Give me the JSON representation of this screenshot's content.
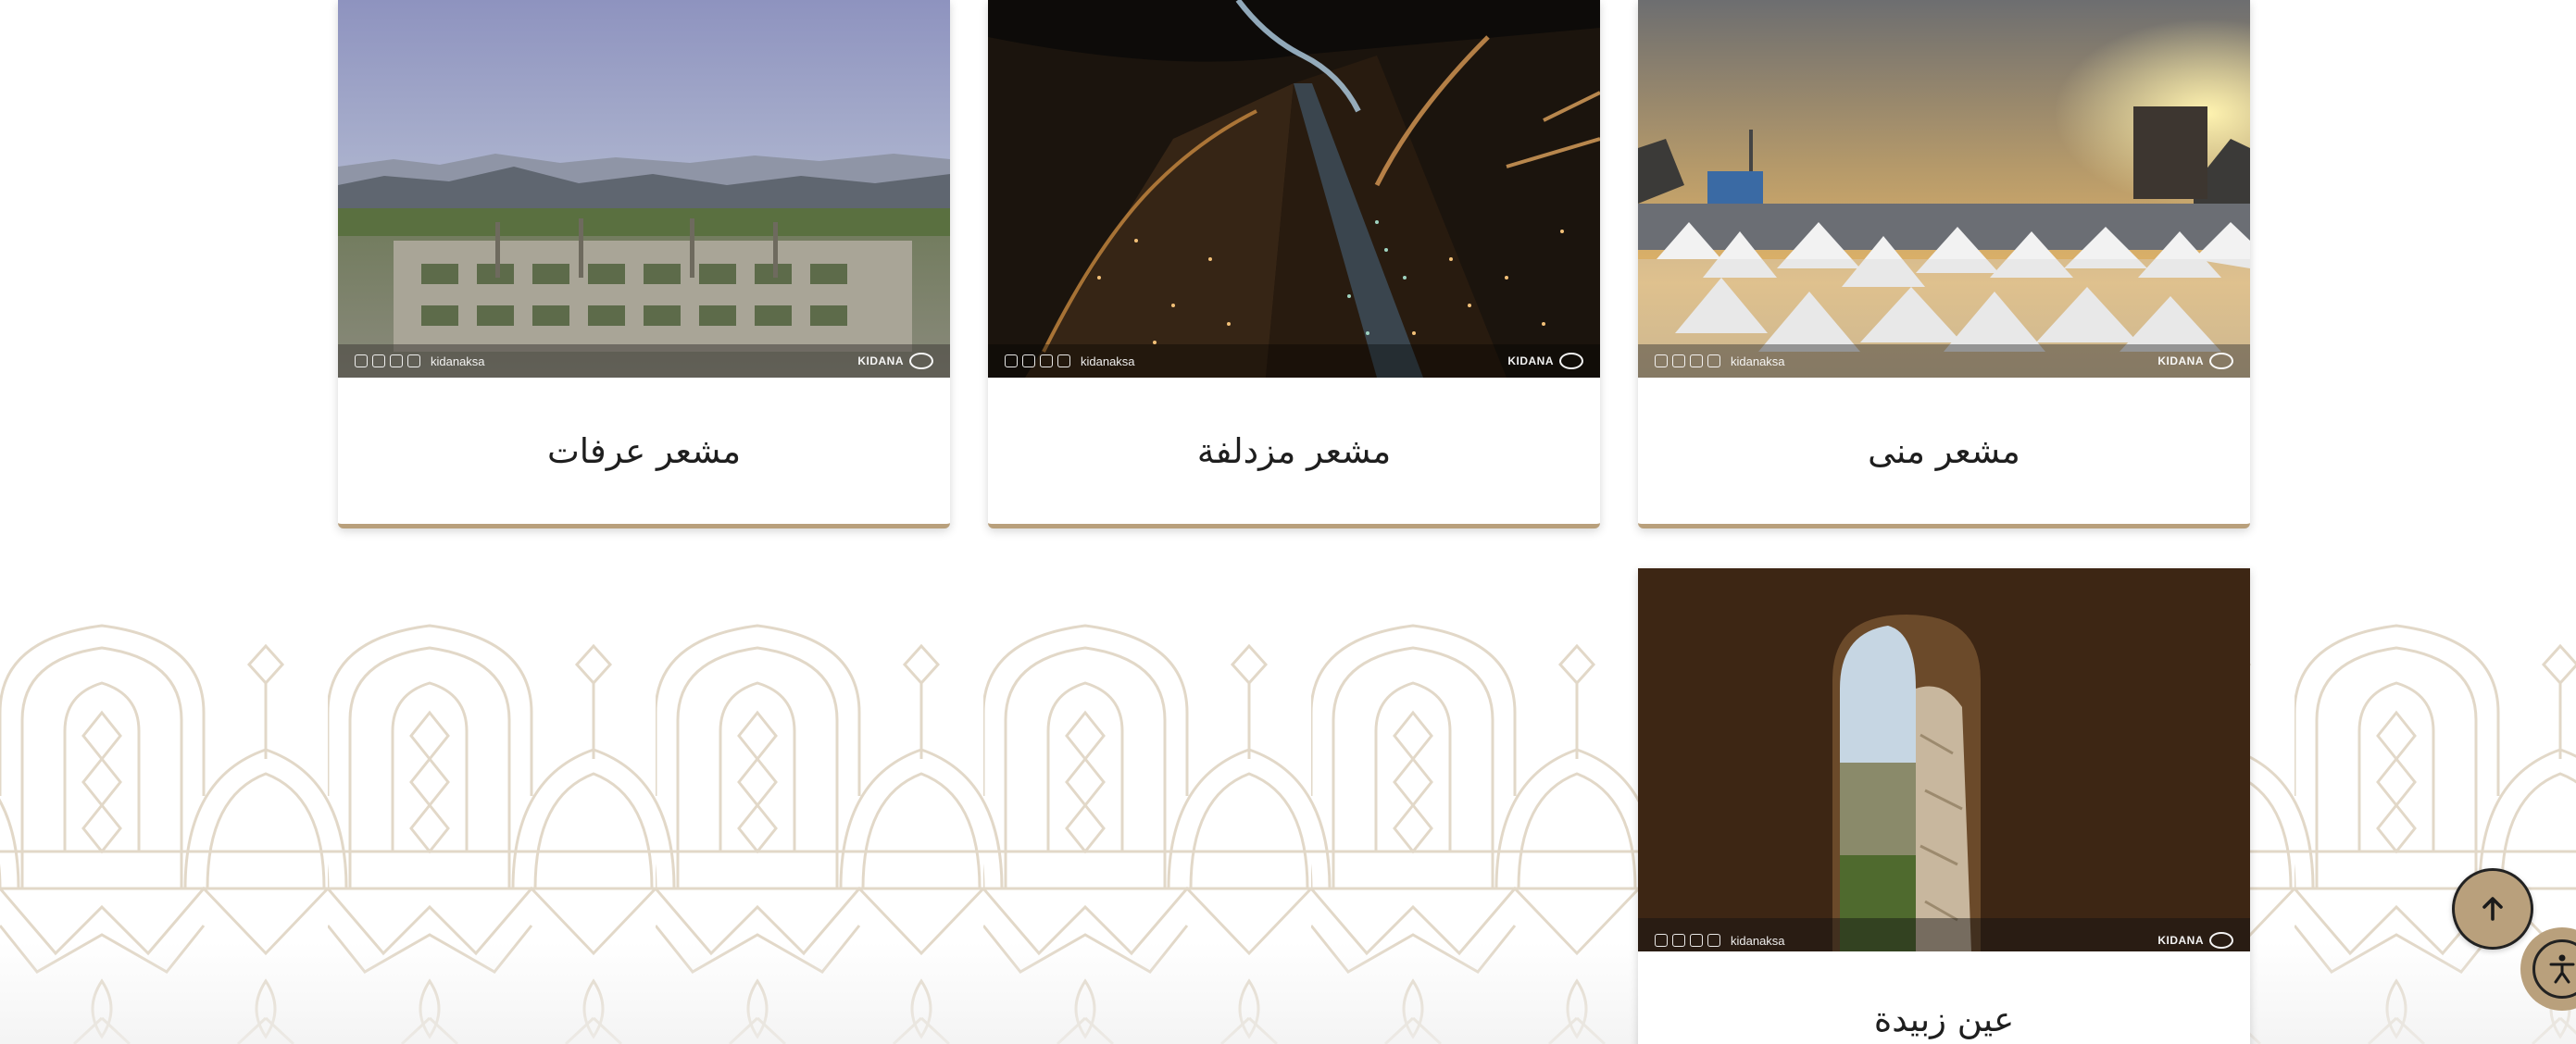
{
  "colors": {
    "accent": "#b9a07c",
    "pattern": "#e2d8c8",
    "title_text": "#1e1e1e"
  },
  "cards": [
    {
      "title": "مشعر عرفات",
      "watermark_handle": "kidanaksa",
      "watermark_brand": "KIDANA"
    },
    {
      "title": "مشعر مزدلفة",
      "watermark_handle": "kidanaksa",
      "watermark_brand": "KIDANA"
    },
    {
      "title": "مشعر منى",
      "watermark_handle": "kidanaksa",
      "watermark_brand": "KIDANA"
    },
    {
      "title": "عين زبيدة",
      "watermark_handle": "kidanaksa",
      "watermark_brand": "KIDANA"
    }
  ],
  "controls": {
    "scroll_top_icon": "arrow-up-icon",
    "accessibility_icon": "accessibility-icon"
  }
}
